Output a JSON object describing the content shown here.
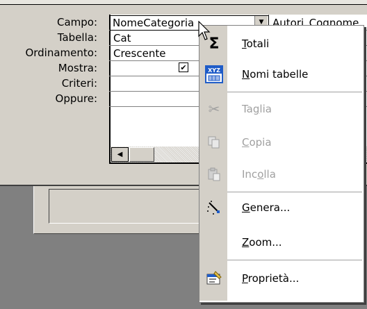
{
  "row_labels": [
    "Campo:",
    "Tabella:",
    "Ordinamento:",
    "Mostra:",
    "Criteri:",
    "Oppure:"
  ],
  "columns": [
    {
      "campo": "NomeCategoria",
      "tabella": "Cat",
      "ordinamento": "Crescente",
      "mostra": true
    },
    {
      "campo": "Autori_Cognome",
      "tabella": "",
      "ordinamento": "",
      "mostra": false
    }
  ],
  "context_menu": {
    "items": [
      {
        "label": "Totali",
        "mnemonic": "T",
        "icon": "sigma-icon",
        "disabled": false
      },
      {
        "label": "Nomi tabelle",
        "mnemonic": "N",
        "icon": "table-names-icon",
        "disabled": false
      },
      {
        "label": "Taglia",
        "mnemonic": "g",
        "icon": "scissors-icon",
        "disabled": true
      },
      {
        "label": "Copia",
        "mnemonic": "C",
        "icon": "copy-icon",
        "disabled": true
      },
      {
        "label": "Incolla",
        "mnemonic": "o",
        "icon": "paste-icon",
        "disabled": true
      },
      {
        "label": "Genera...",
        "mnemonic": "G",
        "icon": "magic-wand-icon",
        "disabled": false
      },
      {
        "label": "Zoom...",
        "mnemonic": "Z",
        "icon": "",
        "disabled": false
      },
      {
        "label": "Proprietà...",
        "mnemonic": "P",
        "icon": "properties-icon",
        "disabled": false
      }
    ],
    "table_names_icon_text": "XYZ"
  },
  "colors": {
    "panel": "#d4d0c8",
    "background": "#808080",
    "disabled_text": "#a0a0a0",
    "icon_blue": "#1f5cc8"
  }
}
